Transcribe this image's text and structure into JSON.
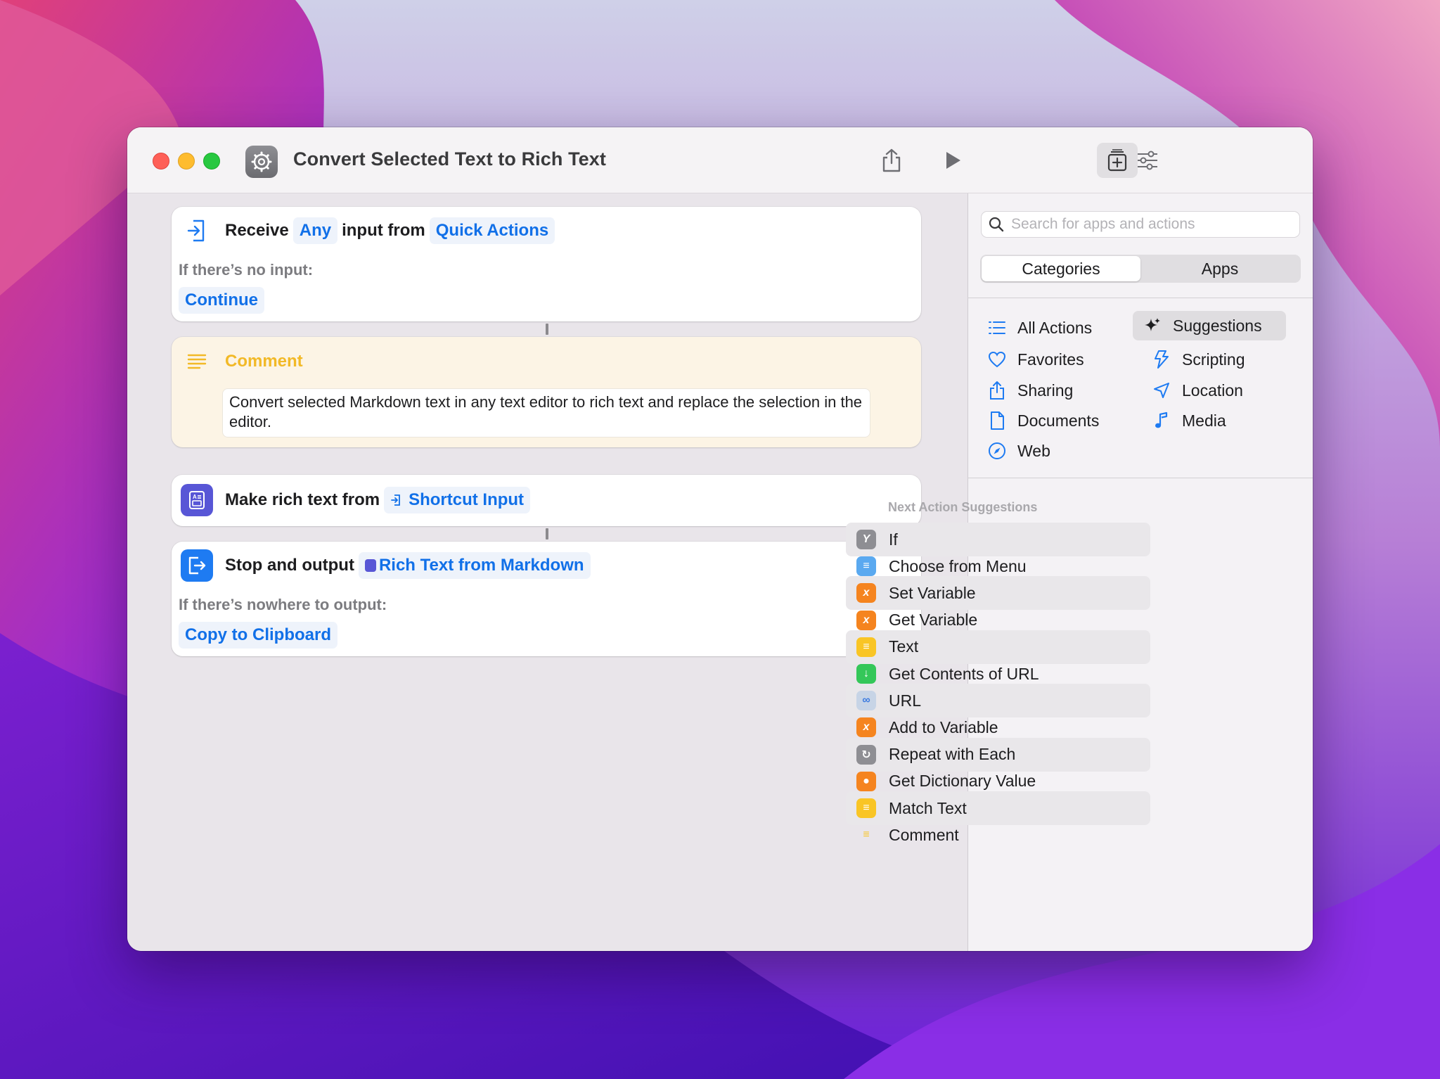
{
  "window": {
    "title": "Convert Selected Text to Rich Text"
  },
  "colors": {
    "accent": "#1170E8",
    "comment_yellow": "#F2B927",
    "orange": "#F5841F",
    "gray_action": "#8E8E93",
    "green": "#34C759",
    "purple_action": "#5856D6",
    "blue_action": "#1E7BF2"
  },
  "editor": {
    "receive": {
      "label": "Receive",
      "type_token": "Any",
      "middle": "input from",
      "source_token": "Quick Actions",
      "no_input_label": "If there’s no input:",
      "no_input_action": "Continue"
    },
    "comment": {
      "title": "Comment",
      "text": "Convert selected Markdown text in any text editor to rich text and replace the selection in the editor."
    },
    "make_rich": {
      "label": "Make rich text from",
      "token": "Shortcut Input"
    },
    "stop_output": {
      "label": "Stop and output",
      "token": "Rich Text from Markdown",
      "nowhere_label": "If there’s nowhere to output:",
      "nowhere_action": "Copy to Clipboard"
    }
  },
  "sidebar": {
    "search_placeholder": "Search for apps and actions",
    "tabs": [
      {
        "label": "Categories",
        "active": true
      },
      {
        "label": "Apps",
        "active": false
      }
    ],
    "categories_left": [
      {
        "label": "All Actions",
        "icon": "list-icon"
      },
      {
        "label": "Favorites",
        "icon": "heart-icon"
      },
      {
        "label": "Sharing",
        "icon": "share-icon"
      },
      {
        "label": "Documents",
        "icon": "document-icon"
      },
      {
        "label": "Web",
        "icon": "compass-icon"
      }
    ],
    "categories_right": [
      {
        "label": "Suggestions",
        "icon": "sparkle-icon",
        "selected": true
      },
      {
        "label": "Scripting",
        "icon": "scripting-icon"
      },
      {
        "label": "Location",
        "icon": "location-arrow-icon"
      },
      {
        "label": "Media",
        "icon": "music-note-icon"
      }
    ],
    "suggestions_title": "Next Action Suggestions",
    "suggestions": [
      {
        "label": "If",
        "icon": "branch-icon",
        "color": "#8E8E93"
      },
      {
        "label": "Choose from Menu",
        "icon": "menu-icon",
        "color": "#5AA9F0"
      },
      {
        "label": "Set Variable",
        "icon": "variable-icon",
        "color": "#F5841F"
      },
      {
        "label": "Get Variable",
        "icon": "variable-icon",
        "color": "#F5841F"
      },
      {
        "label": "Text",
        "icon": "text-icon",
        "color": "#F9C525"
      },
      {
        "label": "Get Contents of URL",
        "icon": "download-icon",
        "color": "#34C759"
      },
      {
        "label": "URL",
        "icon": "link-icon",
        "color": "#C7D4E6"
      },
      {
        "label": "Add to Variable",
        "icon": "variable-icon",
        "color": "#F5841F"
      },
      {
        "label": "Repeat with Each",
        "icon": "repeat-icon",
        "color": "#8E8E93"
      },
      {
        "label": "Get Dictionary Value",
        "icon": "dictionary-icon",
        "color": "#F5841F"
      },
      {
        "label": "Match Text",
        "icon": "text-icon",
        "color": "#F9C525"
      },
      {
        "label": "Comment",
        "icon": "comment-lines-icon",
        "color": "#F9C525"
      }
    ]
  }
}
